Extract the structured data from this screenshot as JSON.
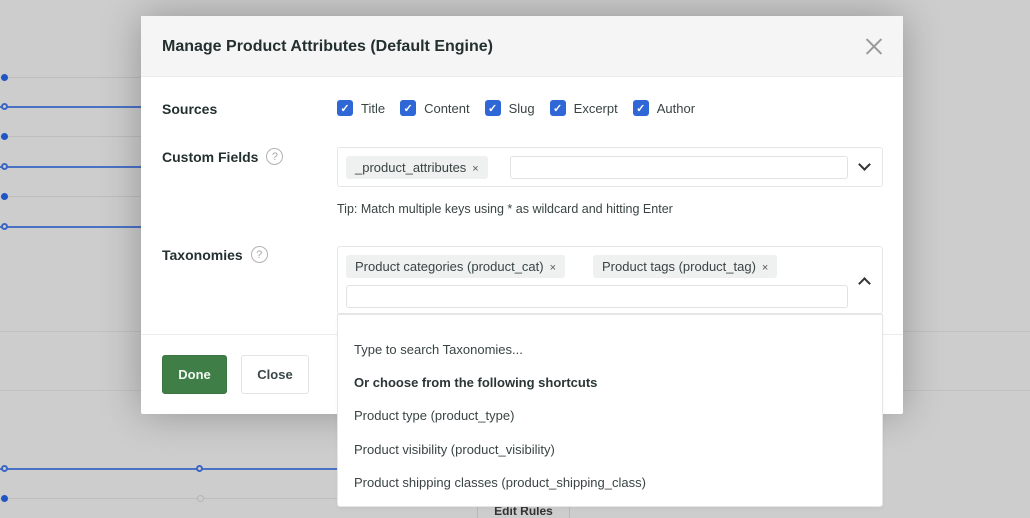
{
  "background": {
    "edit_rules_label": "Edit Rules"
  },
  "modal": {
    "title": "Manage Product Attributes (Default Engine)",
    "close_icon": "close-x-icon",
    "sources": {
      "label": "Sources",
      "items": [
        {
          "label": "Title",
          "checked": true
        },
        {
          "label": "Content",
          "checked": true
        },
        {
          "label": "Slug",
          "checked": true
        },
        {
          "label": "Excerpt",
          "checked": true
        },
        {
          "label": "Author",
          "checked": true
        }
      ]
    },
    "custom_fields": {
      "label": "Custom Fields",
      "help_icon": "question-circle-icon",
      "help_glyph": "?",
      "selected": [
        "_product_attributes"
      ],
      "input_value": "",
      "remove_glyph": "×",
      "tip": "Tip: Match multiple keys using * as wildcard and hitting Enter"
    },
    "taxonomies": {
      "label": "Taxonomies",
      "help_icon": "question-circle-icon",
      "help_glyph": "?",
      "selected": [
        "Product categories (product_cat)",
        "Product tags (product_tag)"
      ],
      "input_value": "",
      "remove_glyph": "×",
      "dropdown": {
        "search_hint": "Type to search Taxonomies...",
        "shortcuts_heading": "Or choose from the following shortcuts",
        "options": [
          "Product type (product_type)",
          "Product visibility (product_visibility)",
          "Product shipping classes (product_shipping_class)"
        ]
      }
    },
    "footer": {
      "done_label": "Done",
      "close_label": "Close"
    }
  },
  "colors": {
    "accent_blue": "#2f67d6",
    "done_green": "#3f7f47",
    "overlay_grey": "#cdcdcd"
  }
}
